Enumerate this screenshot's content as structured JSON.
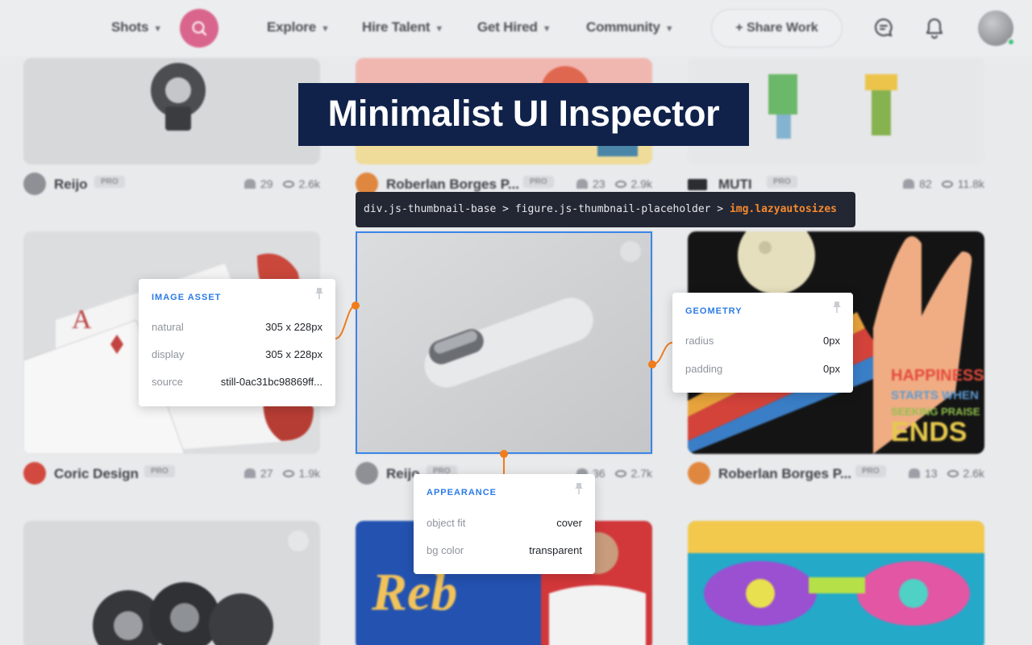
{
  "nav": {
    "items": [
      "Shots",
      "Explore",
      "Hire Talent",
      "Get Hired",
      "Community"
    ],
    "share_label": "+ Share Work",
    "icons": [
      "search-icon",
      "chat-icon",
      "bell-icon",
      "chevron-down-icon"
    ],
    "accent": "#d9658c",
    "online_color": "#3ec17c"
  },
  "shots": [
    {
      "author": "Reijo",
      "badge": "PRO",
      "likes": "29",
      "views": "2.6k"
    },
    {
      "author": "Roberlan Borges P...",
      "badge": "PRO",
      "likes": "23",
      "views": "2.9k"
    },
    {
      "author": "MUTI",
      "badge": "PRO",
      "likes": "82",
      "views": "11.8k"
    },
    {
      "author": "Coric Design",
      "badge": "PRO",
      "likes": "27",
      "views": "1.9k"
    },
    {
      "author": "Reijo",
      "badge": "PRO",
      "likes": "36",
      "views": "2.7k"
    },
    {
      "author": "Roberlan Borges P...",
      "badge": "PRO",
      "likes": "13",
      "views": "2.6k"
    }
  ],
  "overlay": {
    "title": "Minimalist UI Inspector",
    "selector_path": "div.js-thumbnail-base > figure.js-thumbnail-placeholder > ",
    "selector_target": "img.lazyautosizes",
    "highlight_color": "#f5892e",
    "outline_color": "#3a86e8"
  },
  "cards": {
    "image_asset": {
      "heading": "IMAGE ASSET",
      "rows": [
        {
          "label": "natural",
          "value": "305 x 228px"
        },
        {
          "label": "display",
          "value": "305 x 228px"
        },
        {
          "label": "source",
          "value": "still-0ac31bc98869ff..."
        }
      ]
    },
    "geometry": {
      "heading": "GEOMETRY",
      "rows": [
        {
          "label": "radius",
          "value": "0px"
        },
        {
          "label": "padding",
          "value": "0px"
        }
      ]
    },
    "appearance": {
      "heading": "APPEARANCE",
      "rows": [
        {
          "label": "object fit",
          "value": "cover"
        },
        {
          "label": "bg color",
          "value": "transparent"
        }
      ]
    }
  }
}
